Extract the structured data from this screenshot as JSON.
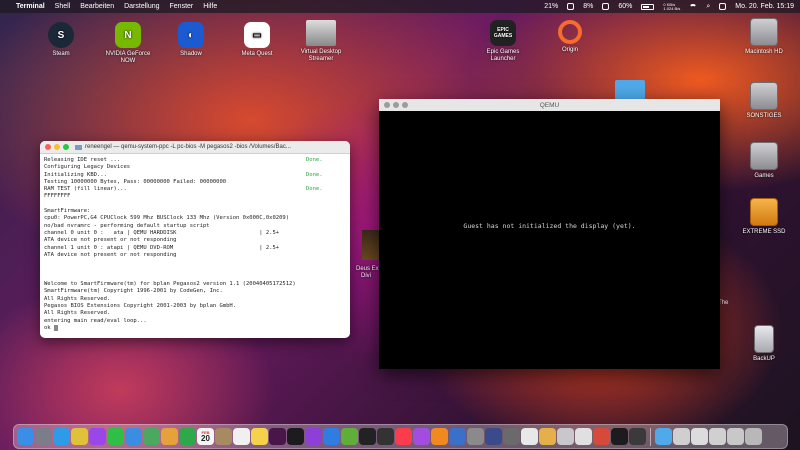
{
  "menubar": {
    "apple": "",
    "items": [
      "Terminal",
      "Shell",
      "Bearbeiten",
      "Darstellung",
      "Fenster",
      "Hilfe"
    ],
    "battery_1": "21%",
    "battery_2": "8%",
    "battery_3": "60%",
    "net_up": "0 KB/s",
    "net_down": "1.024 B/s",
    "datetime": "Mo. 20. Feb. 15:19"
  },
  "desktop": {
    "steam": "Steam",
    "geforce_1": "NVIDIA GeForce",
    "geforce_2": "NOW",
    "shadow": "Shadow",
    "meta": "Meta Quest",
    "vds_1": "Virtual Desktop",
    "vds_2": "Streamer",
    "epic_glyph": "EPIC\nGAMES",
    "epic_1": "Epic Games",
    "epic_2": "Launcher",
    "origin": "Origin",
    "macintosh_hd": "Macintosh HD",
    "sonstiges": "SONSTIGES",
    "games": "Games",
    "extreme_ssd": "EXTREME SSD",
    "backup": "BackUP",
    "deus_1": "Deus Ex",
    "deus_2": "Divi",
    "the": "The"
  },
  "terminal": {
    "title": "reneengel — qemu-system-ppc -L pc-bios -M pegasos2 -bios /Volumes/Bac...",
    "lines": [
      {
        "t": "Releasing IDE reset ...",
        "s": "Done."
      },
      {
        "t": "Configuring Legacy Devices",
        "s": ""
      },
      {
        "t": "Initializing KBD...",
        "s": "Done."
      },
      {
        "t": "Testing 10000000 Bytes, Pass: 00000000 Failed: 00000000",
        "s": ""
      },
      {
        "t": "RAM TEST (fill linear)...",
        "s": "Done."
      },
      {
        "t": "FFFFFFFF",
        "s": ""
      },
      {
        "t": "",
        "s": ""
      },
      {
        "t": "SmartFirmware:",
        "s": ""
      },
      {
        "t": "cpu0: PowerPC,G4 CPUClock 599 Mhz BUSClock 133 Mhz (Version 0x000C,0x0209)",
        "s": ""
      },
      {
        "t": "no/bad nvramrc - performing default startup script",
        "s": ""
      },
      {
        "t": "channel 0 unit 0 :   ata | QEMU HARDDISK                         | 2.5+",
        "s": ""
      },
      {
        "t": "ATA device not present or not responding",
        "s": ""
      },
      {
        "t": "channel 1 unit 0 : atapi | QEMU DVD-ROM                          | 2.5+",
        "s": ""
      },
      {
        "t": "ATA device not present or not responding",
        "s": ""
      },
      {
        "t": "",
        "s": ""
      },
      {
        "t": "",
        "s": ""
      },
      {
        "t": "",
        "s": ""
      },
      {
        "t": "Welcome to SmartFirmware(tm) for bplan Pegasos2 version 1.1 (20040405172512)",
        "s": ""
      },
      {
        "t": "SmartFirmware(tm) Copyright 1996-2001 by CodeGen, Inc.",
        "s": ""
      },
      {
        "t": "All Rights Reserved.",
        "s": ""
      },
      {
        "t": "Pegasos BIOS Extensions Copyright 2001-2003 by bplan GmbH.",
        "s": ""
      },
      {
        "t": "All Rights Reserved.",
        "s": ""
      },
      {
        "t": "entering main read/eval loop...",
        "s": ""
      }
    ],
    "prompt": "ok "
  },
  "qemu": {
    "title": "QEMU",
    "message": "Guest has not initialized the display (yet)."
  },
  "dock": {
    "calendar_day": "20",
    "calendar_month": "FEB",
    "items": [
      {
        "name": "finder",
        "color": "#3b8ee8"
      },
      {
        "name": "launchpad",
        "color": "#7d7d8a"
      },
      {
        "name": "safari",
        "color": "#2d9be8"
      },
      {
        "name": "chrome",
        "color": "#e0c23a"
      },
      {
        "name": "messenger",
        "color": "#9a46e8"
      },
      {
        "name": "messages",
        "color": "#2fbf47"
      },
      {
        "name": "mail",
        "color": "#3a8de0"
      },
      {
        "name": "maps",
        "color": "#4aa860"
      },
      {
        "name": "photos",
        "color": "#e6a23a"
      },
      {
        "name": "facetime",
        "color": "#2da84a"
      },
      {
        "name": "calendar",
        "color": "#f5f5f5"
      },
      {
        "name": "contacts",
        "color": "#a88a62"
      },
      {
        "name": "reminders",
        "color": "#f0f0f0"
      },
      {
        "name": "notes",
        "color": "#f4d24a"
      },
      {
        "name": "slack",
        "color": "#4a1548"
      },
      {
        "name": "tv",
        "color": "#1c1c1e"
      },
      {
        "name": "podcasts",
        "color": "#8e3fd8"
      },
      {
        "name": "app-store",
        "color": "#2f7de0"
      },
      {
        "name": "adblock",
        "color": "#5fae3a"
      },
      {
        "name": "terminal",
        "color": "#222"
      },
      {
        "name": "activity",
        "color": "#333"
      },
      {
        "name": "music",
        "color": "#fa3c4c"
      },
      {
        "name": "podcasts2",
        "color": "#a24de0"
      },
      {
        "name": "books",
        "color": "#f08a20"
      },
      {
        "name": "word",
        "color": "#3b6fc8"
      },
      {
        "name": "sysprefs",
        "color": "#8a8a8a"
      },
      {
        "name": "vpn",
        "color": "#3a4a8a"
      },
      {
        "name": "app-a",
        "color": "#6a6a6a"
      },
      {
        "name": "app-b",
        "color": "#e8e8e8"
      },
      {
        "name": "app-c",
        "color": "#e4b04a"
      },
      {
        "name": "app-d",
        "color": "#c7c7cc"
      },
      {
        "name": "app-e",
        "color": "#e0e0e0"
      },
      {
        "name": "app-f",
        "color": "#d64a3a"
      },
      {
        "name": "app-g",
        "color": "#1c1c1e"
      },
      {
        "name": "app-h",
        "color": "#3a3a3a"
      }
    ],
    "trailing": [
      {
        "name": "downloads",
        "color": "#4fa9ea"
      },
      {
        "name": "window-1",
        "color": "#cfcfcf"
      },
      {
        "name": "window-2",
        "color": "#dcdcdc"
      },
      {
        "name": "window-3",
        "color": "#d0d0d0"
      },
      {
        "name": "window-4",
        "color": "#c8c8c8"
      },
      {
        "name": "trash",
        "color": "#b8b8b8"
      }
    ]
  }
}
